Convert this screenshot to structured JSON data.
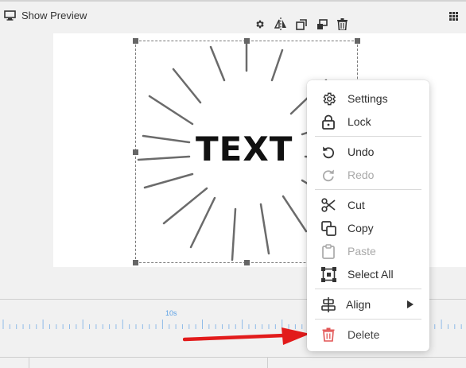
{
  "header": {
    "preview_label": "Show Preview",
    "icons": {
      "preview": "monitor-icon",
      "grid": "grid-menu-icon"
    }
  },
  "toolbar": {
    "icons": [
      "gear-icon",
      "flip-icon",
      "bring-forward-icon",
      "send-backward-icon",
      "trash-icon"
    ]
  },
  "artwork": {
    "text": "TEXT"
  },
  "timeline": {
    "marker_label": "10s"
  },
  "context_menu": {
    "items": [
      {
        "id": "settings",
        "label": "Settings",
        "icon": "gear-icon",
        "disabled": false
      },
      {
        "id": "lock",
        "label": "Lock",
        "icon": "lock-icon",
        "disabled": false
      },
      {
        "id": "undo",
        "label": "Undo",
        "icon": "undo-icon",
        "disabled": false
      },
      {
        "id": "redo",
        "label": "Redo",
        "icon": "redo-icon",
        "disabled": true
      },
      {
        "id": "cut",
        "label": "Cut",
        "icon": "scissors-icon",
        "disabled": false
      },
      {
        "id": "copy",
        "label": "Copy",
        "icon": "copy-icon",
        "disabled": false
      },
      {
        "id": "paste",
        "label": "Paste",
        "icon": "clipboard-icon",
        "disabled": true
      },
      {
        "id": "select_all",
        "label": "Select All",
        "icon": "select-all-icon",
        "disabled": false
      },
      {
        "id": "align",
        "label": "Align",
        "icon": "align-icon",
        "disabled": false,
        "submenu": true
      },
      {
        "id": "delete",
        "label": "Delete",
        "icon": "trash-icon",
        "disabled": false
      }
    ]
  },
  "colors": {
    "accent_blue": "#5aa0e6",
    "delete_red": "#e25555",
    "pointer_arrow": "#e21b1b",
    "disabled_text": "#a9a9a9"
  }
}
